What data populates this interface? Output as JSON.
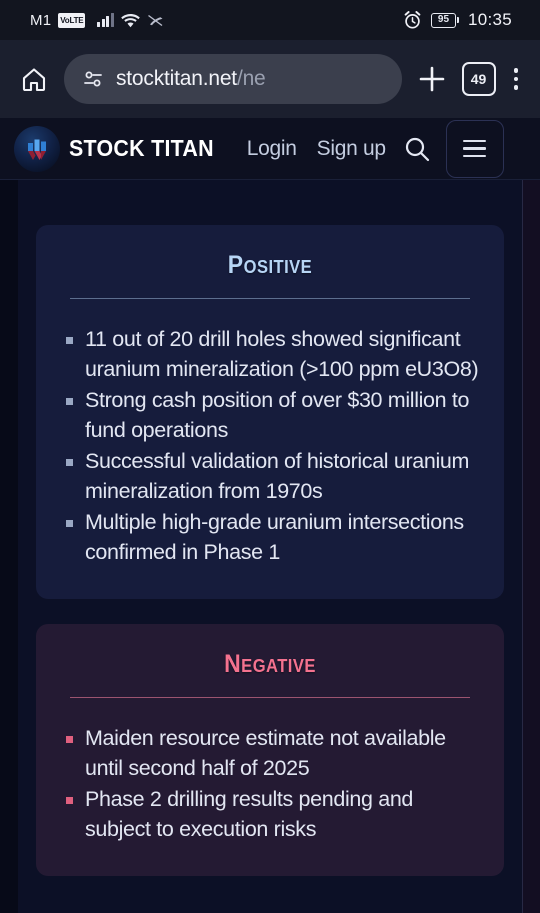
{
  "status_bar": {
    "carrier": "M1",
    "network_badge": "VoLTE",
    "signal_icon": "signal-bars-icon",
    "wifi_icon": "wifi-icon",
    "vibrate_icon": "vibrate-icon",
    "alarm_icon": "alarm-clock-icon",
    "battery_percent": "95",
    "time": "10:35"
  },
  "browser": {
    "home_icon": "home-icon",
    "site_settings_icon": "site-settings-icon",
    "url": "stocktitan.net",
    "url_suffix": "/ne",
    "new_tab_icon": "plus-icon",
    "tab_count": "49",
    "menu_icon": "overflow-menu-icon"
  },
  "site_header": {
    "logo_icon": "stock-titan-logo-icon",
    "brand": "STOCK TITAN",
    "login_label": "Login",
    "signup_label": "Sign up",
    "search_icon": "search-icon",
    "menu_icon": "hamburger-menu-icon"
  },
  "cards": [
    {
      "id": "positive",
      "title": "Positive",
      "accent": "#b7d5f5",
      "background": "#161c3c",
      "bullets": [
        "11 out of 20 drill holes showed significant uranium mineralization (>100 ppm eU3O8)",
        "Strong cash position of over $30 million to fund operations",
        "Successful validation of historical uranium mineralization from 1970s",
        "Multiple high-grade uranium intersections confirmed in Phase 1"
      ]
    },
    {
      "id": "negative",
      "title": "Negative",
      "accent": "#f4728f",
      "background": "#241a33",
      "bullets": [
        "Maiden resource estimate not available until second half of 2025",
        "Phase 2 drilling results pending and subject to execution risks"
      ]
    }
  ]
}
